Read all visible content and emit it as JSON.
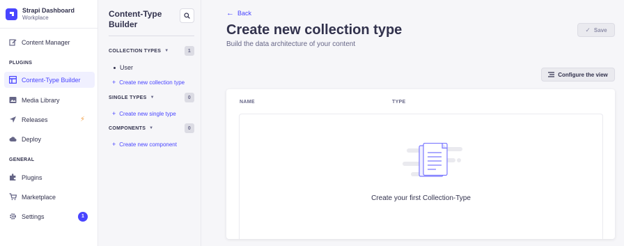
{
  "brand": {
    "title": "Strapi Dashboard",
    "subtitle": "Workplace"
  },
  "nav": {
    "content_manager": "Content Manager",
    "plugins_section": "PLUGINS",
    "content_type_builder": "Content-Type Builder",
    "media_library": "Media Library",
    "releases": "Releases",
    "deploy": "Deploy",
    "general_section": "GENERAL",
    "plugins": "Plugins",
    "marketplace": "Marketplace",
    "settings": "Settings",
    "settings_badge": "1"
  },
  "subnav": {
    "title": "Content-Type Builder",
    "collection_types": {
      "label": "COLLECTION TYPES",
      "count": "1",
      "items": [
        "User"
      ],
      "create": "Create new collection type"
    },
    "single_types": {
      "label": "SINGLE TYPES",
      "count": "0",
      "create": "Create new single type"
    },
    "components": {
      "label": "COMPONENTS",
      "count": "0",
      "create": "Create new component"
    }
  },
  "main": {
    "back": "Back",
    "title": "Create new collection type",
    "subtitle": "Build the data architecture of your content",
    "save": "Save",
    "configure_view": "Configure the view",
    "table": {
      "col_name": "NAME",
      "col_type": "TYPE",
      "empty": "Create your first Collection-Type"
    }
  },
  "colors": {
    "accent": "#4945ff",
    "bolt": "#f29d41"
  }
}
